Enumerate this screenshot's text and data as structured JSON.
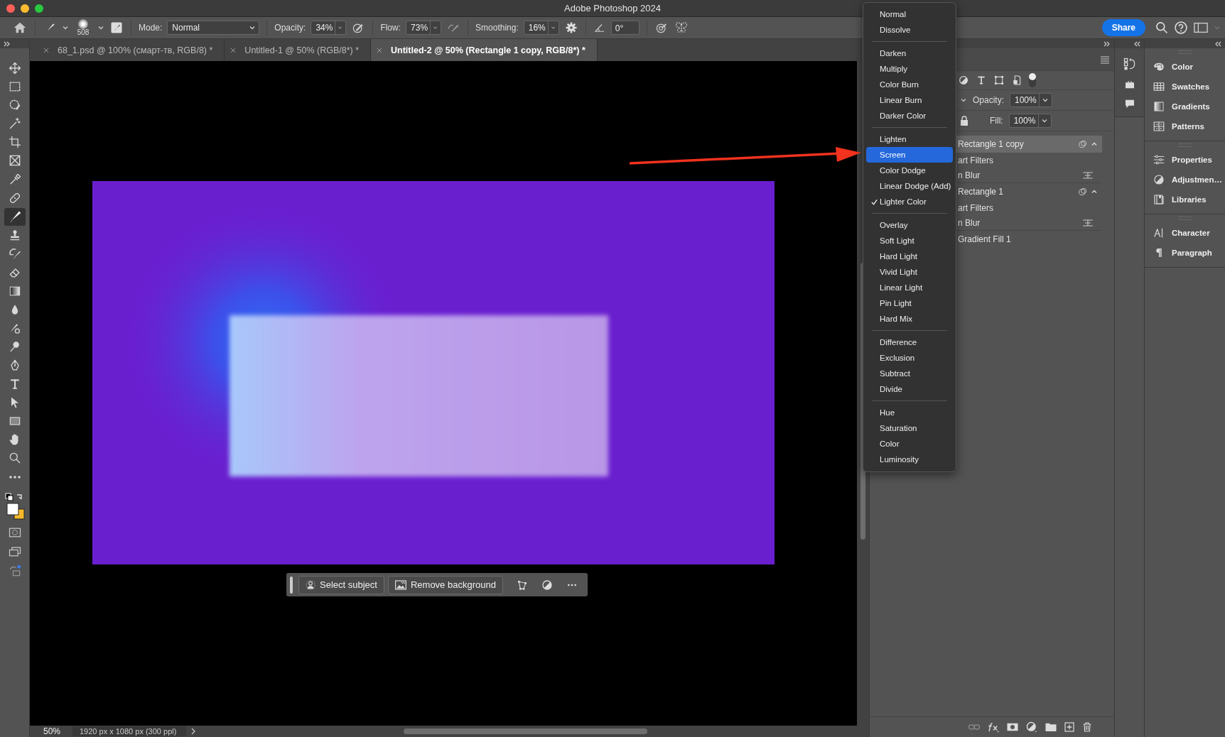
{
  "window": {
    "title": "Adobe Photoshop 2024"
  },
  "options_bar": {
    "brush_size": "508",
    "mode_label": "Mode:",
    "mode": "Normal",
    "opacity_label": "Opacity:",
    "opacity": "34%",
    "flow_label": "Flow:",
    "flow": "73%",
    "smoothing_label": "Smoothing:",
    "smoothing": "16%",
    "angle": "0°",
    "share": "Share"
  },
  "tabs": [
    {
      "label": "68_1.psd @ 100% (смарт-тв, RGB/8) *",
      "selected": false
    },
    {
      "label": "Untitled-1 @ 50% (RGB/8*) *",
      "selected": false
    },
    {
      "label": "Untitled-2 @ 50% (Rectangle 1 copy, RGB/8*) *",
      "selected": true
    }
  ],
  "tools": [
    {
      "kind": "move",
      "selected": false
    },
    {
      "kind": "marquee",
      "selected": false
    },
    {
      "kind": "select",
      "selected": false
    },
    {
      "kind": "wand",
      "selected": false
    },
    {
      "kind": "crop",
      "selected": false
    },
    {
      "kind": "frame",
      "selected": false
    },
    {
      "kind": "eyedropper",
      "selected": false
    },
    {
      "kind": "heal",
      "selected": false
    },
    {
      "kind": "brush",
      "selected": true
    },
    {
      "kind": "stamp",
      "selected": false
    },
    {
      "kind": "history",
      "selected": false
    },
    {
      "kind": "eraser",
      "selected": false
    },
    {
      "kind": "gradient",
      "selected": false
    },
    {
      "kind": "drop",
      "selected": false
    },
    {
      "kind": "smudge",
      "selected": false
    },
    {
      "kind": "dodge",
      "selected": false
    },
    {
      "kind": "pen",
      "selected": false
    },
    {
      "kind": "type",
      "selected": false
    },
    {
      "kind": "pointer",
      "selected": false
    },
    {
      "kind": "shape",
      "selected": false
    },
    {
      "kind": "hand",
      "selected": false
    },
    {
      "kind": "zoom",
      "selected": false
    },
    {
      "kind": "more",
      "selected": false
    }
  ],
  "canvas_toolbar": {
    "buttons": [
      "Select subject",
      "Remove background"
    ]
  },
  "status_bar": {
    "zoom": "50%",
    "info": "1920 px x 1080 px (300 ppl)"
  },
  "blend_menu": {
    "groups": [
      [
        {
          "label": "Normal",
          "selected": false,
          "checked": false
        },
        {
          "label": "Dissolve",
          "selected": false,
          "checked": false
        }
      ],
      [
        {
          "label": "Darken",
          "selected": false,
          "checked": false
        },
        {
          "label": "Multiply",
          "selected": false,
          "checked": false
        },
        {
          "label": "Color Burn",
          "selected": false,
          "checked": false
        },
        {
          "label": "Linear Burn",
          "selected": false,
          "checked": false
        },
        {
          "label": "Darker Color",
          "selected": false,
          "checked": false
        }
      ],
      [
        {
          "label": "Lighten",
          "selected": false,
          "checked": false
        },
        {
          "label": "Screen",
          "selected": true,
          "checked": false
        },
        {
          "label": "Color Dodge",
          "selected": false,
          "checked": false
        },
        {
          "label": "Linear Dodge (Add)",
          "selected": false,
          "checked": false
        },
        {
          "label": "Lighter Color",
          "selected": false,
          "checked": true
        }
      ],
      [
        {
          "label": "Overlay",
          "selected": false,
          "checked": false
        },
        {
          "label": "Soft Light",
          "selected": false,
          "checked": false
        },
        {
          "label": "Hard Light",
          "selected": false,
          "checked": false
        },
        {
          "label": "Vivid Light",
          "selected": false,
          "checked": false
        },
        {
          "label": "Linear Light",
          "selected": false,
          "checked": false
        },
        {
          "label": "Pin Light",
          "selected": false,
          "checked": false
        },
        {
          "label": "Hard Mix",
          "selected": false,
          "checked": false
        }
      ],
      [
        {
          "label": "Difference",
          "selected": false,
          "checked": false
        },
        {
          "label": "Exclusion",
          "selected": false,
          "checked": false
        },
        {
          "label": "Subtract",
          "selected": false,
          "checked": false
        },
        {
          "label": "Divide",
          "selected": false,
          "checked": false
        }
      ],
      [
        {
          "label": "Hue",
          "selected": false,
          "checked": false
        },
        {
          "label": "Saturation",
          "selected": false,
          "checked": false
        },
        {
          "label": "Color",
          "selected": false,
          "checked": false
        },
        {
          "label": "Luminosity",
          "selected": false,
          "checked": false
        }
      ]
    ]
  },
  "layers_panel": {
    "opacity_label": "Opacity:",
    "opacity": "100%",
    "fill_label": "Fill:",
    "fill": "100%",
    "layers": [
      {
        "name": "Rectangle 1 copy",
        "kind": "smart",
        "selected": true,
        "children": [
          {
            "name": "art Filters",
            "kind": "filters"
          },
          {
            "name": "n Blur",
            "kind": "filter"
          }
        ]
      },
      {
        "name": "Rectangle 1",
        "kind": "smart",
        "selected": false,
        "children": [
          {
            "name": "art Filters",
            "kind": "filters"
          },
          {
            "name": "n Blur",
            "kind": "filter"
          }
        ]
      },
      {
        "name": "Gradient Fill 1",
        "kind": "fill",
        "selected": false
      }
    ]
  },
  "side_panels": {
    "groups": [
      [
        {
          "label": "Color",
          "kind": "palette"
        },
        {
          "label": "Swatches",
          "kind": "grid"
        },
        {
          "label": "Gradients",
          "kind": "gradient"
        },
        {
          "label": "Patterns",
          "kind": "pattern"
        }
      ],
      [
        {
          "label": "Properties",
          "kind": "sliders"
        },
        {
          "label": "Adjustmen…",
          "kind": "adjust"
        },
        {
          "label": "Libraries",
          "kind": "library"
        }
      ],
      [
        {
          "label": "Character",
          "kind": "character"
        },
        {
          "label": "Paragraph",
          "kind": "paragraph"
        }
      ]
    ]
  }
}
